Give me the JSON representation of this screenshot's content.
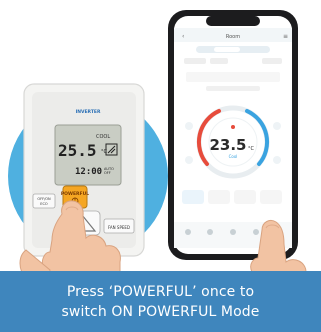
{
  "caption": {
    "line1": "Press ‘POWERFUL’ once to",
    "line2": "switch ON POWERFUL Mode"
  },
  "remote": {
    "brand": "INVERTER",
    "mode_text": "COOL",
    "temperature": "25.5",
    "temperature_unit": "°C",
    "clock": "12:00",
    "clock_suffix": "AUTO\nOFF",
    "button_powerful": "POWERFUL",
    "button_eco": "ECO",
    "button_off_on": "OFF/ON",
    "button_fan_speed": "FAN SPEED"
  },
  "phone": {
    "app_title": "Room",
    "temperature": "23.5",
    "temperature_unit": "°C",
    "mode_label": "Cool",
    "nav_items": [
      "",
      "",
      "",
      "",
      ""
    ]
  },
  "colors": {
    "caption_bg": "#3f86bd",
    "circle_bg": "#4fb0e0",
    "powerful_button": "#f5a623",
    "phone_frame": "#1c1c1e",
    "dial_red": "#e74c3c",
    "dial_blue": "#3aa3e0"
  }
}
